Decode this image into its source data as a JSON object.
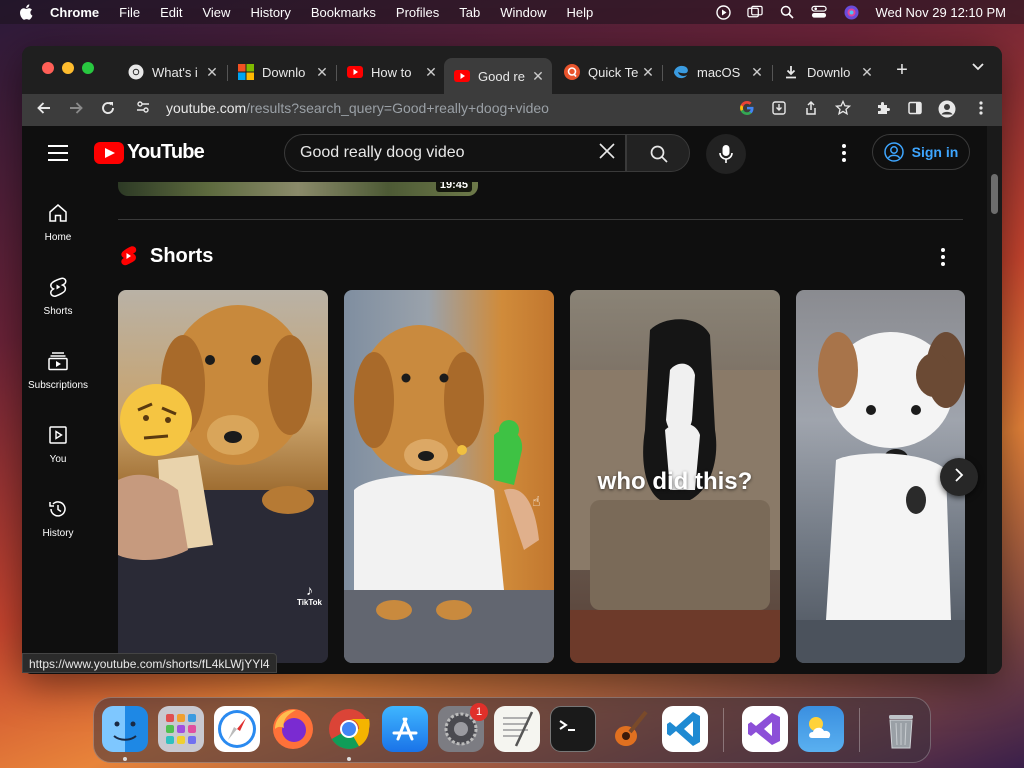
{
  "menubar": {
    "app_name": "Chrome",
    "menus": [
      "File",
      "Edit",
      "View",
      "History",
      "Bookmarks",
      "Profiles",
      "Tab",
      "Window",
      "Help"
    ],
    "clock": "Wed Nov 29  12:10 PM"
  },
  "tabs": [
    {
      "title": "What's i",
      "icon": "chrome-icon"
    },
    {
      "title": "Downlo",
      "icon": "microsoft-icon"
    },
    {
      "title": "How to",
      "icon": "youtube-icon"
    },
    {
      "title": "Good re",
      "icon": "youtube-icon",
      "active": true
    },
    {
      "title": "Quick Te",
      "icon": "quick-icon"
    },
    {
      "title": "macOS",
      "icon": "edge-icon"
    },
    {
      "title": "Downlo",
      "icon": "download-icon"
    }
  ],
  "omnibox": {
    "host": "youtube.com",
    "path": "/results?search_query=Good+really+doog+video"
  },
  "youtube": {
    "logo_text": "YouTube",
    "search_query": "Good really doog video",
    "sign_in": "Sign in",
    "nav": [
      {
        "label": "Home",
        "icon": "home-icon"
      },
      {
        "label": "Shorts",
        "icon": "shorts-icon"
      },
      {
        "label": "Subscriptions",
        "icon": "subscriptions-icon"
      },
      {
        "label": "You",
        "icon": "you-icon"
      },
      {
        "label": "History",
        "icon": "history-icon"
      }
    ],
    "prev_video_duration": "19:45",
    "shorts_title": "Shorts",
    "shorts": [
      {
        "caption": "",
        "watermark": "TikTok"
      },
      {
        "caption": ""
      },
      {
        "caption": "who did this?"
      },
      {
        "caption": ""
      }
    ]
  },
  "status_url": "https://www.youtube.com/shorts/fL4kLWjYYl4",
  "dock": {
    "apps": [
      "finder-icon",
      "launchpad-icon",
      "safari-icon",
      "firefox-icon",
      "chrome-icon",
      "app-store-icon",
      "system-settings-icon",
      "textedit-icon",
      "terminal-icon",
      "garageband-icon",
      "vscode-icon",
      "visual-studio-icon",
      "weather-icon",
      "trash-icon"
    ],
    "settings_badge": "1"
  },
  "colors": {
    "yt_red": "#ff0000",
    "link_blue": "#3ea6ff",
    "page_bg": "#0f0f0f"
  }
}
